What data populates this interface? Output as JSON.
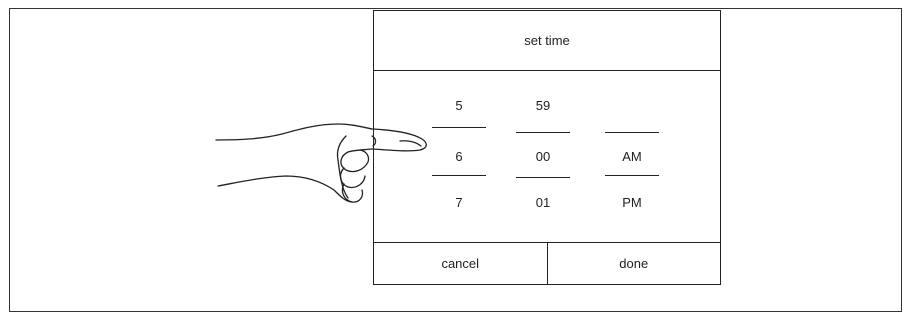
{
  "dialog": {
    "title": "set time",
    "hour_wheel": {
      "above": "5",
      "selected": "6",
      "below": "7"
    },
    "minute_wheel": {
      "above": "59",
      "selected": "00",
      "below": "01"
    },
    "period_wheel": {
      "above": "",
      "selected": "AM",
      "below": "PM"
    },
    "cancel_label": "cancel",
    "done_label": "done"
  },
  "colors": {
    "stroke": "#222222",
    "background": "#ffffff"
  }
}
